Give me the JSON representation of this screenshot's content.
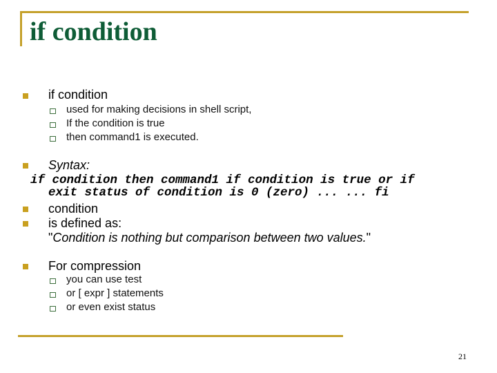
{
  "slide": {
    "title": "if condition",
    "page_number": "21",
    "accent_color": "#c4a02a",
    "title_color": "#0e5c36",
    "sections": [
      {
        "heading": "if condition",
        "items": [
          "used for making decisions in shell script,",
          "If the condition is true",
          "then command1 is executed."
        ]
      },
      {
        "heading": "Syntax:",
        "code_line1": "if condition then command1 if condition is true or if",
        "code_line2": "exit status of condition is 0 (zero) ... ... fi"
      },
      {
        "heading": "condition"
      },
      {
        "heading": "is defined as:",
        "quote_open": "\"",
        "quote_text": "Condition is nothing but comparison between two values.",
        "quote_close": "\""
      },
      {
        "heading": "For compression",
        "items": [
          "you can use test",
          "or [ expr ] statements",
          "or even exist status"
        ]
      }
    ]
  }
}
